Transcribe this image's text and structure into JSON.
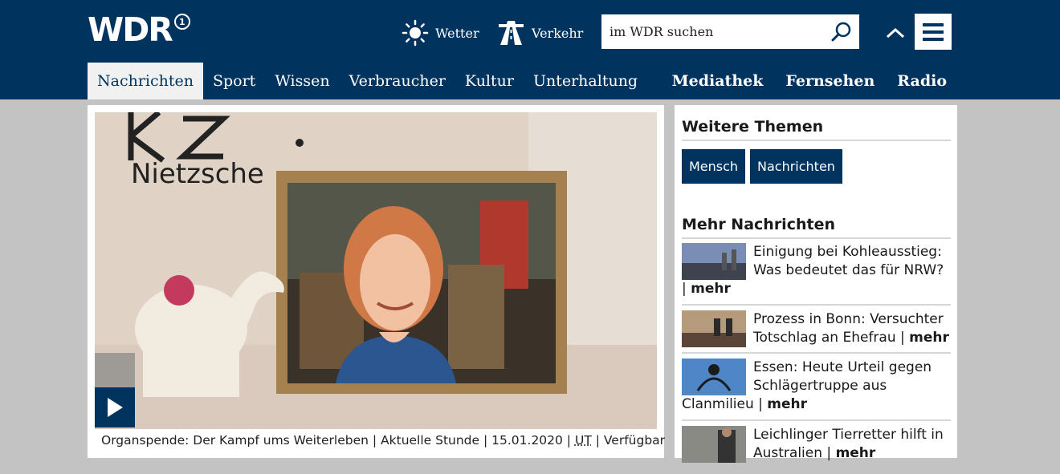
{
  "header": {
    "logo": "WDR",
    "logo_badge": "1",
    "weather_label": "Wetter",
    "traffic_label": "Verkehr",
    "search_placeholder": "im WDR suchen"
  },
  "nav": {
    "items": [
      "Nachrichten",
      "Sport",
      "Wissen",
      "Verbraucher",
      "Kultur",
      "Unterhaltung"
    ],
    "right_items": [
      "Mediathek",
      "Fernsehen",
      "Radio"
    ]
  },
  "video": {
    "caption": "Organspende: Der Kampf ums Weiterleben | Aktuelle Stunde | 15.01.2020 |",
    "caption_ut": "UT",
    "caption_tail": "| Verfügbar",
    "wall_text": "Nietzsche"
  },
  "sidebar": {
    "topics_title": "Weitere Themen",
    "topics": [
      "Mensch",
      "Nachrichten"
    ],
    "news_title": "Mehr Nachrichten",
    "news": [
      {
        "text": "Einigung bei Kohleausstieg: Was bedeutet das für NRW? |",
        "more": "mehr"
      },
      {
        "text": "Prozess in Bonn: Versuchter Totschlag an Ehefrau |",
        "more": "mehr"
      },
      {
        "text": "Essen: Heute Urteil gegen Schlägertruppe aus Clanmilieu |",
        "more": "mehr"
      },
      {
        "text": "Leichlinger Tierretter hilft in Australien |",
        "more": "mehr"
      }
    ]
  },
  "colors": {
    "brand_blue": "#00345f",
    "page_bg": "#c3c3c3"
  }
}
